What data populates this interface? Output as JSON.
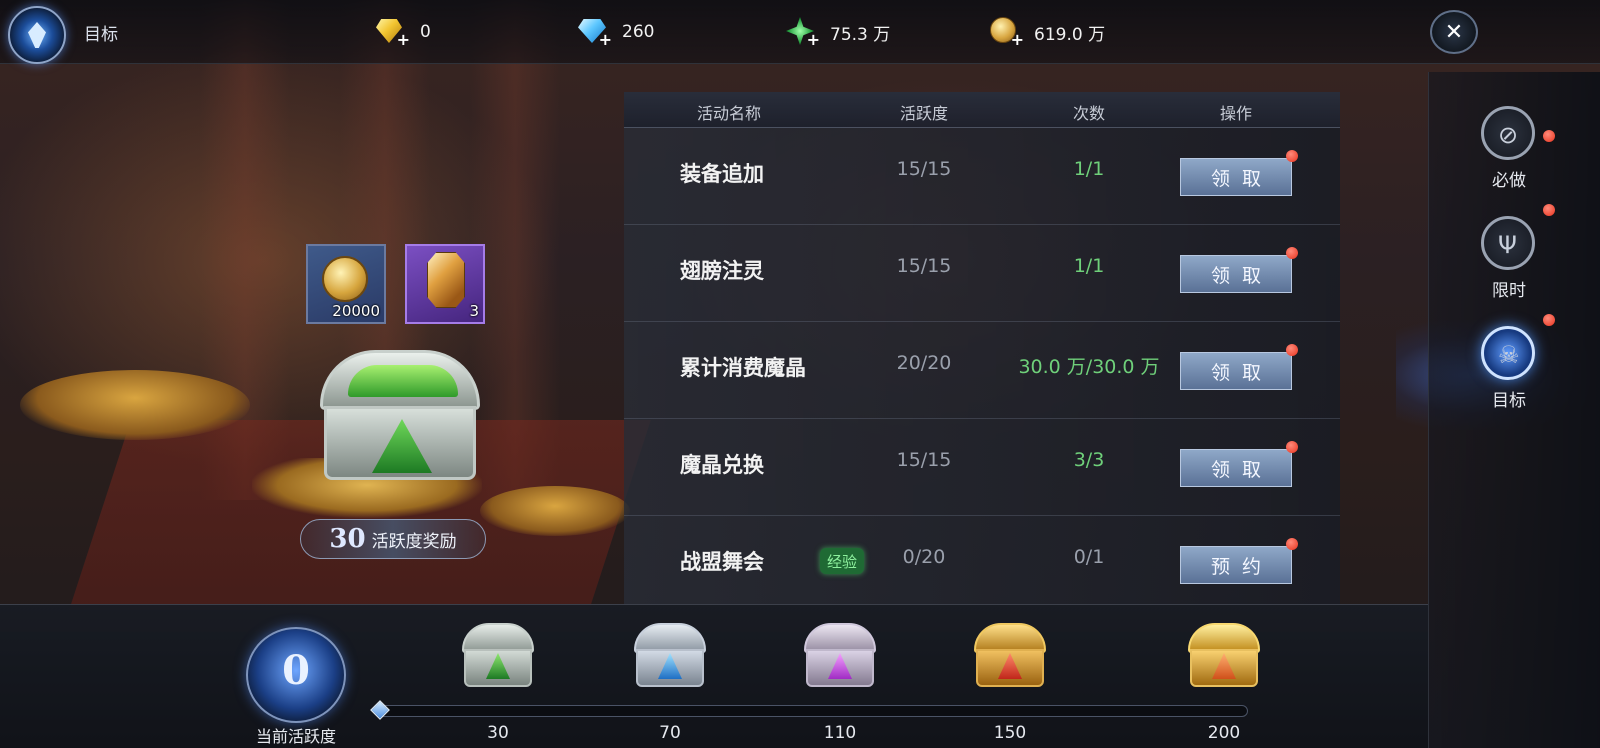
{
  "header": {
    "title": "目标",
    "close_label": "✕",
    "resources": [
      {
        "icon": "gold-diamond-icon",
        "value": "0"
      },
      {
        "icon": "blue-diamond-icon",
        "value": "260"
      },
      {
        "icon": "green-crystal-icon",
        "value": "75.3 万"
      },
      {
        "icon": "gold-coin-icon",
        "value": "619.0 万"
      }
    ],
    "plus_label": "+"
  },
  "reward": {
    "items": [
      {
        "icon": "gold-coin-icon",
        "count": "20000"
      },
      {
        "icon": "amber-crystal-icon",
        "count": "3"
      }
    ],
    "threshold": "30",
    "label": "活跃度奖励"
  },
  "table": {
    "headers": [
      "活动名称",
      "活跃度",
      "次数",
      "操作"
    ],
    "rows": [
      {
        "name": "装备追加",
        "activity": "15/15",
        "count": "1/1",
        "action": "领取"
      },
      {
        "name": "翅膀注灵",
        "activity": "15/15",
        "count": "1/1",
        "action": "领取"
      },
      {
        "name": "累计消费魔晶",
        "activity": "20/20",
        "count": "30.0 万/30.0 万",
        "action": "领取"
      },
      {
        "name": "魔晶兑换",
        "activity": "15/15",
        "count": "3/3",
        "action": "领取"
      },
      {
        "name": "战盟舞会",
        "tag": "经验",
        "activity": "0/20",
        "count": "0/1",
        "action": "预约"
      }
    ]
  },
  "sidebar": {
    "items": [
      {
        "label": "必做",
        "icon": "compass-icon",
        "active": false
      },
      {
        "label": "限时",
        "icon": "trident-icon",
        "active": false
      },
      {
        "label": "目标",
        "icon": "skull-icon",
        "active": true
      }
    ]
  },
  "progress": {
    "current_value": "0",
    "current_label": "当前活跃度",
    "fraction": 0.0,
    "milestones": [
      {
        "value": "30",
        "chest": "green-chest-icon"
      },
      {
        "value": "70",
        "chest": "blue-chest-icon"
      },
      {
        "value": "110",
        "chest": "purple-chest-icon"
      },
      {
        "value": "150",
        "chest": "red-gold-chest-icon"
      },
      {
        "value": "200",
        "chest": "gold-chest-icon"
      }
    ]
  },
  "colors": {
    "count_done": "#6fd07a",
    "badge_red": "#e8321d",
    "accent_blue": "#5f9cff"
  }
}
